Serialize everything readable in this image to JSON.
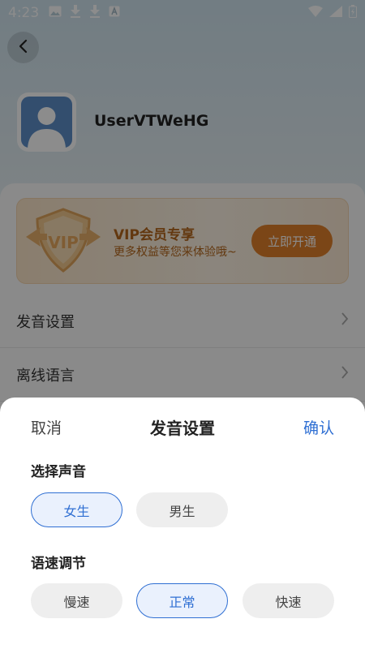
{
  "status_bar": {
    "time": "4:23",
    "left_icons": [
      "image-icon",
      "download-icon",
      "download-icon",
      "font-icon"
    ],
    "right_icons": [
      "wifi-icon",
      "signal-icon",
      "battery-icon"
    ]
  },
  "profile": {
    "username": "UserVTWeHG"
  },
  "vip": {
    "title": "VIP会员专享",
    "subtitle": "更多权益等您来体验哦~",
    "button_label": "立即开通",
    "badge_text": "VIP"
  },
  "menu": {
    "items": [
      {
        "label": "发音设置"
      },
      {
        "label": "离线语言"
      }
    ]
  },
  "sheet": {
    "cancel_label": "取消",
    "title": "发音设置",
    "confirm_label": "确认",
    "voice_section": {
      "label": "选择声音",
      "options": [
        {
          "label": "女生",
          "selected": true
        },
        {
          "label": "男生",
          "selected": false
        }
      ]
    },
    "speed_section": {
      "label": "语速调节",
      "options": [
        {
          "label": "慢速",
          "selected": false
        },
        {
          "label": "正常",
          "selected": true
        },
        {
          "label": "快速",
          "selected": false
        }
      ]
    }
  },
  "colors": {
    "accent": "#2f6fd3",
    "vip_text": "#b5671c",
    "vip_button": "#e0802a"
  }
}
